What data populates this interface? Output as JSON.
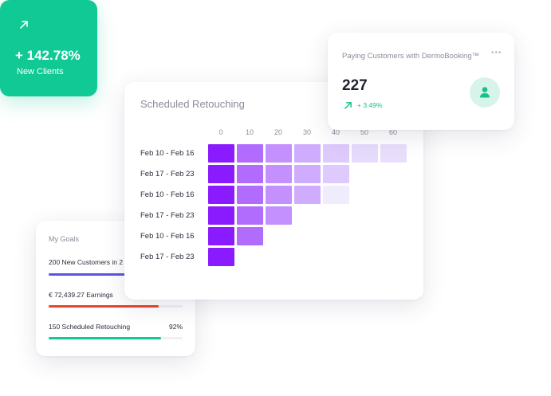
{
  "paying": {
    "title": "Paying Customers with DermoBooking™",
    "dots": "•••",
    "value": "227",
    "change": "+ 3.49%",
    "arrow_icon": "arrow-up-right-icon",
    "avatar_icon": "user-icon",
    "accent": "#18c08e"
  },
  "scheduled": {
    "title": "Scheduled Retouching"
  },
  "chart_data": {
    "type": "heatmap",
    "title": "Scheduled Retouching",
    "x_ticks": [
      "0",
      "10",
      "20",
      "30",
      "40",
      "50",
      "60"
    ],
    "rows": [
      "Feb 10 - Feb 16",
      "Feb 17 - Feb 23",
      "Feb 10 - Feb 16",
      "Feb 17 - Feb 23",
      "Feb 10 - Feb 16",
      "Feb 17 - Feb 23"
    ],
    "cells": [
      [
        1.0,
        0.62,
        0.45,
        0.32,
        0.18,
        0.1,
        0.08
      ],
      [
        1.0,
        0.62,
        0.45,
        0.32,
        0.18
      ],
      [
        1.0,
        0.62,
        0.45,
        0.32,
        0.02
      ],
      [
        1.0,
        0.62,
        0.45
      ],
      [
        1.0,
        0.62
      ],
      [
        1.0
      ]
    ],
    "colors": {
      "high": "#8a1bff",
      "low": "#f1f0fd"
    }
  },
  "goals": {
    "title": "My Goals",
    "items": [
      {
        "label": "200 New Customers in 2",
        "pct": "",
        "fill": 0.95,
        "color": "#5a55e0"
      },
      {
        "label": "€ 72,439.27 Earnings",
        "pct": "",
        "fill": 0.82,
        "color": "#e6462a"
      },
      {
        "label": "150 Scheduled Retouching",
        "pct": "92%",
        "fill": 0.84,
        "color": "#11c994"
      }
    ]
  },
  "green": {
    "value": "+ 142.78%",
    "label": "New Clients",
    "arrow_icon": "arrow-up-right-icon",
    "color": "#11c994"
  }
}
